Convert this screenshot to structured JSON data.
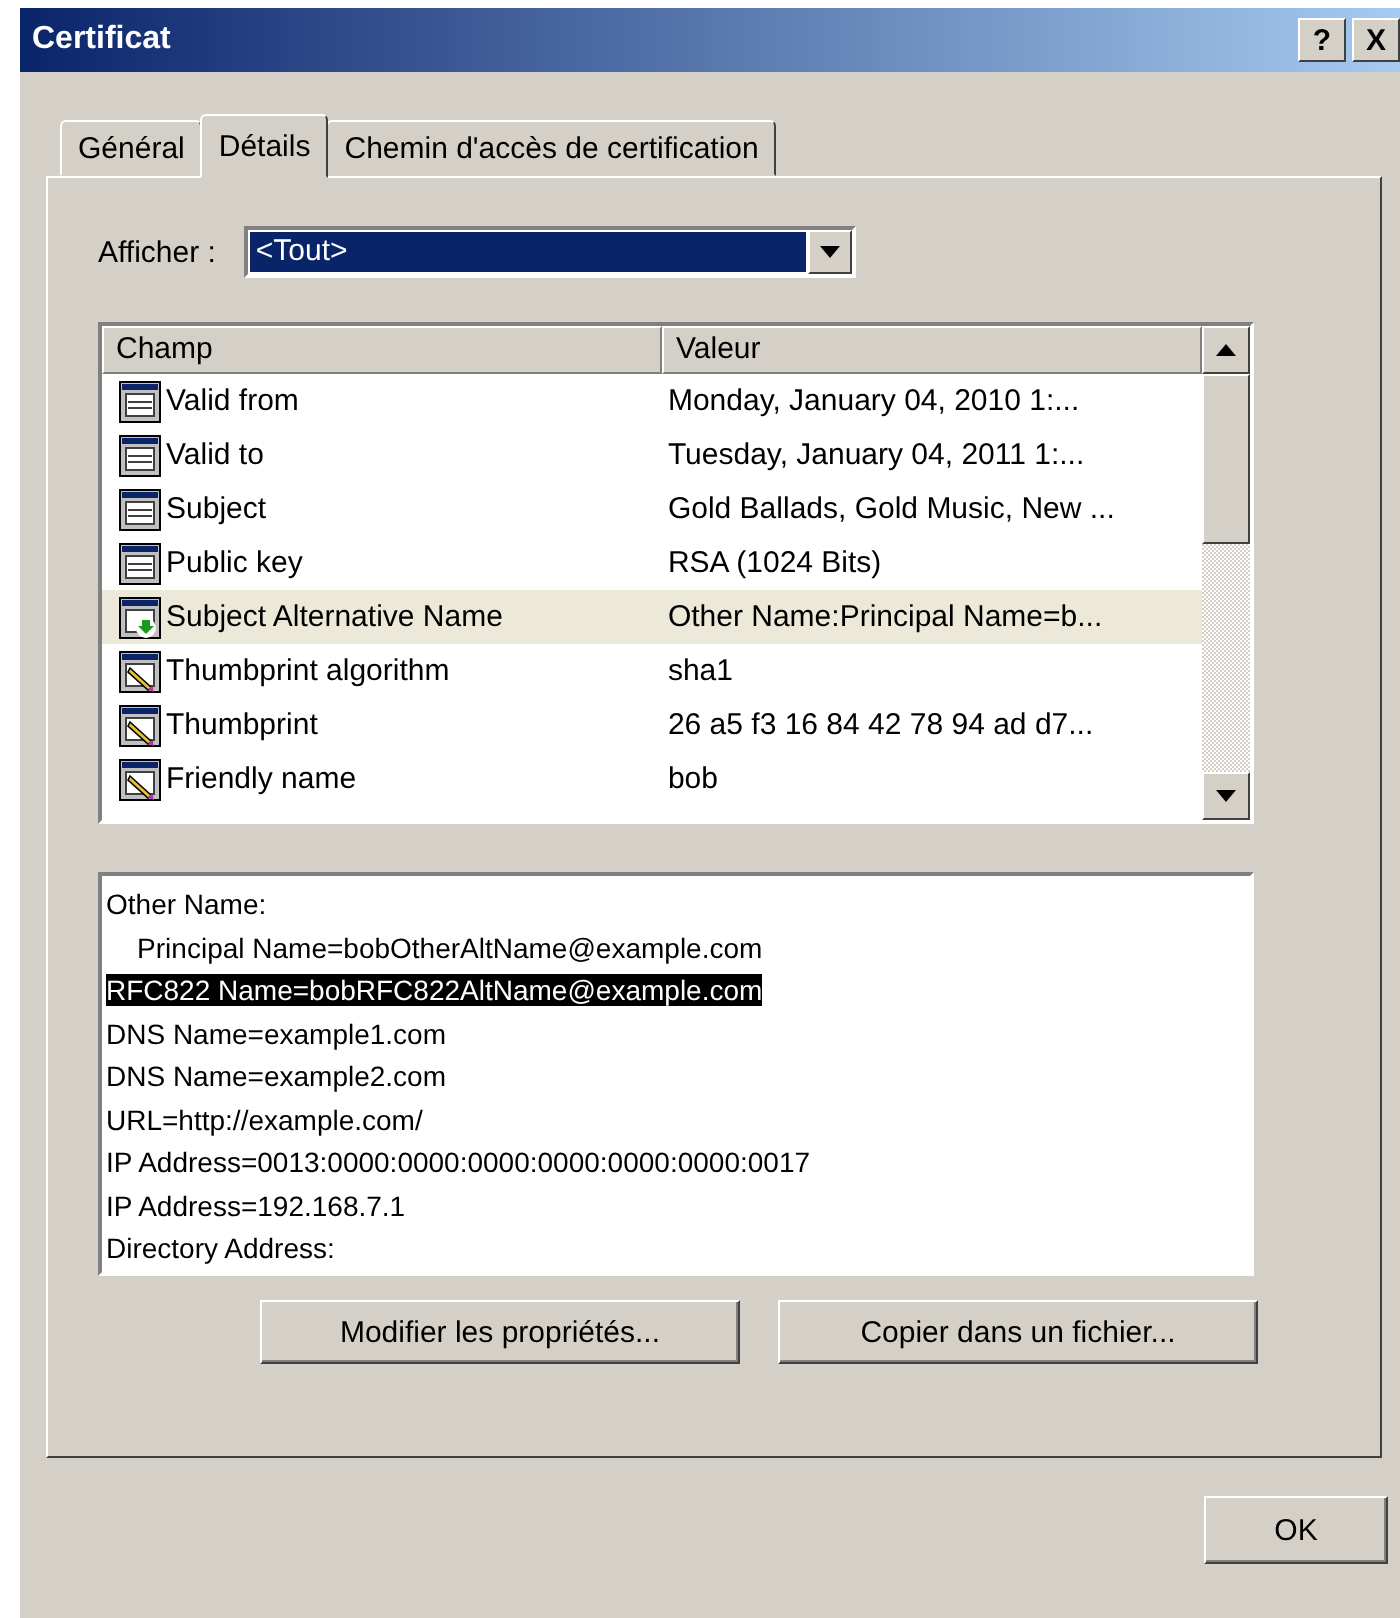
{
  "window": {
    "title": "Certificat",
    "help_button": "?",
    "close_button": "X"
  },
  "tabs": [
    {
      "label": "Général",
      "selected": false
    },
    {
      "label": "Détails",
      "selected": true
    },
    {
      "label": "Chemin d'accès de certification",
      "selected": false
    }
  ],
  "show": {
    "label": "Afficher :",
    "value": "<Tout>"
  },
  "fields": {
    "columns": [
      "Champ",
      "Valeur"
    ],
    "rows": [
      {
        "kind": "field",
        "name": "Valid from",
        "value": "Monday, January 04, 2010 1:...",
        "selected": false
      },
      {
        "kind": "field",
        "name": "Valid to",
        "value": "Tuesday, January 04, 2011 1:...",
        "selected": false
      },
      {
        "kind": "field",
        "name": "Subject",
        "value": "Gold Ballads, Gold Music, New ...",
        "selected": false
      },
      {
        "kind": "field",
        "name": "Public key",
        "value": "RSA (1024 Bits)",
        "selected": false
      },
      {
        "kind": "extension",
        "name": "Subject Alternative Name",
        "value": "Other Name:Principal Name=b...",
        "selected": true
      },
      {
        "kind": "property",
        "name": "Thumbprint algorithm",
        "value": "sha1",
        "selected": false
      },
      {
        "kind": "property",
        "name": "Thumbprint",
        "value": "26 a5 f3 16 84 42 78 94 ad d7...",
        "selected": false
      },
      {
        "kind": "property",
        "name": "Friendly name",
        "value": "bob",
        "selected": false
      }
    ]
  },
  "details": [
    {
      "text": "Other Name:",
      "selected": false
    },
    {
      "text": "    Principal Name=bobOtherAltName@example.com",
      "selected": false
    },
    {
      "text": "RFC822 Name=bobRFC822AltName@example.com",
      "selected": true
    },
    {
      "text": "DNS Name=example1.com",
      "selected": false
    },
    {
      "text": "DNS Name=example2.com",
      "selected": false
    },
    {
      "text": "URL=http://example.com/",
      "selected": false
    },
    {
      "text": "IP Address=0013:0000:0000:0000:0000:0000:0000:0017",
      "selected": false
    },
    {
      "text": "IP Address=192.168.7.1",
      "selected": false
    },
    {
      "text": "Directory Address:",
      "selected": false
    }
  ],
  "actions": [
    "Modifier les propriétés...",
    "Copier dans un fichier..."
  ],
  "ok_button": "OK"
}
